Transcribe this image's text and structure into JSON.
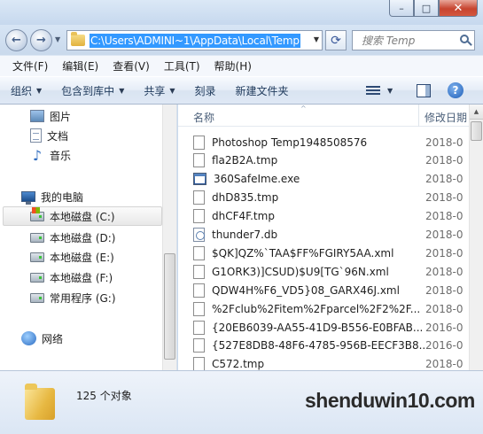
{
  "window": {
    "min_glyph": "–",
    "max_glyph": "□",
    "close_glyph": "✕"
  },
  "address": {
    "path": "C:\\Users\\ADMINI~1\\AppData\\Local\\Temp",
    "search_placeholder": "搜索 Temp"
  },
  "menu": [
    "文件(F)",
    "编辑(E)",
    "查看(V)",
    "工具(T)",
    "帮助(H)"
  ],
  "toolbar": {
    "organize": "组织",
    "include_in_library": "包含到库中",
    "share": "共享",
    "burn": "刻录",
    "new_folder": "新建文件夹",
    "help_glyph": "?"
  },
  "nav": {
    "items": [
      {
        "label": "图片"
      },
      {
        "label": "文档"
      },
      {
        "label": "音乐"
      },
      {
        "label": "我的电脑"
      },
      {
        "label": "本地磁盘 (C:)"
      },
      {
        "label": "本地磁盘 (D:)"
      },
      {
        "label": "本地磁盘 (E:)"
      },
      {
        "label": "本地磁盘 (F:)"
      },
      {
        "label": "常用程序 (G:)"
      },
      {
        "label": "网络"
      }
    ]
  },
  "files": {
    "col_name": "名称",
    "col_date": "修改日期",
    "rows": [
      {
        "name": "Photoshop Temp1948508576",
        "date": "2018-0",
        "icon": "file"
      },
      {
        "name": "fla2B2A.tmp",
        "date": "2018-0",
        "icon": "file"
      },
      {
        "name": "360SafeIme.exe",
        "date": "2018-0",
        "icon": "exe"
      },
      {
        "name": "dhD835.tmp",
        "date": "2018-0",
        "icon": "file"
      },
      {
        "name": "dhCF4F.tmp",
        "date": "2018-0",
        "icon": "file"
      },
      {
        "name": "thunder7.db",
        "date": "2018-0",
        "icon": "db"
      },
      {
        "name": "$QK]QZ%`TAA$FF%FGIRY5AA.xml",
        "date": "2018-0",
        "icon": "file"
      },
      {
        "name": "G1ORK3)]CSUD)$U9[TG`96N.xml",
        "date": "2018-0",
        "icon": "file"
      },
      {
        "name": "QDW4H%F6_VD5}08_GARX46J.xml",
        "date": "2018-0",
        "icon": "file"
      },
      {
        "name": "%2Fclub%2Fitem%2Fparcel%2F2%2F...",
        "date": "2018-0",
        "icon": "file"
      },
      {
        "name": "{20EB6039-AA55-41D9-B556-E0BFAB...",
        "date": "2016-0",
        "icon": "file"
      },
      {
        "name": "{527E8DB8-48F6-4785-956B-EECF3B8...",
        "date": "2016-0",
        "icon": "file"
      },
      {
        "name": "C572.tmp",
        "date": "2018-0",
        "icon": "file"
      }
    ]
  },
  "status": {
    "item_count": "125 个对象"
  },
  "watermark": {
    "text": "shenduwin10.com"
  }
}
